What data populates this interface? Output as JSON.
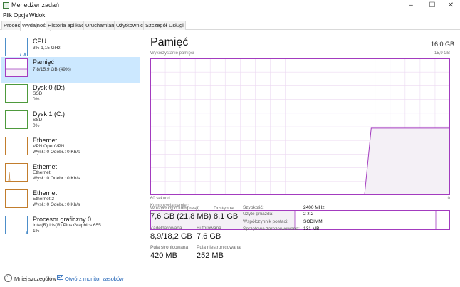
{
  "window": {
    "title": "Menedżer zadań"
  },
  "menu": [
    "Plik",
    "Opcje",
    "Widok"
  ],
  "tabs": [
    {
      "label": "Procesy"
    },
    {
      "label": "Wydajność"
    },
    {
      "label": "Historia aplikacji"
    },
    {
      "label": "Uruchamianie"
    },
    {
      "label": "Użytkownicy"
    },
    {
      "label": "Szczegóły"
    },
    {
      "label": "Usługi"
    }
  ],
  "active_tab": "Wydajność",
  "sidebar": {
    "items": [
      {
        "title": "CPU",
        "sub1": "3% 1,15 GHz",
        "sub2": "",
        "sub3": "",
        "color": "#4d8ec9"
      },
      {
        "title": "Pamięć",
        "sub1": "7,8/15,9 GB (49%)",
        "sub2": "",
        "sub3": "",
        "color": "#a33bbf"
      },
      {
        "title": "Dysk 0 (D:)",
        "sub1": "SSD",
        "sub2": "0%",
        "sub3": "",
        "color": "#4e9a3d"
      },
      {
        "title": "Dysk 1 (C:)",
        "sub1": "SSD",
        "sub2": "0%",
        "sub3": "",
        "color": "#4e9a3d"
      },
      {
        "title": "Ethernet",
        "sub1": "VPN OpenVPN",
        "sub2": "Wysł.: 0 Odebr.: 0 Kb/s",
        "sub3": "",
        "color": "#c27d2d"
      },
      {
        "title": "Ethernet",
        "sub1": "Ethernet",
        "sub2": "Wysł.: 0 Odebr.: 0 Kb/s",
        "sub3": "",
        "color": "#c27d2d"
      },
      {
        "title": "Ethernet",
        "sub1": "Ethernet 2",
        "sub2": "Wysł.: 0 Odebr.: 0 Kb/s",
        "sub3": "",
        "color": "#c27d2d"
      },
      {
        "title": "Procesor graficzny 0",
        "sub1": "Intel(R) Iris(R) Plus Graphics 655",
        "sub2": "1%",
        "sub3": "",
        "color": "#4d8ec9"
      }
    ],
    "selected": "Pamięć"
  },
  "main": {
    "title": "Pamięć",
    "capacity": "16,0 GB",
    "usage_label": "Wykorzystanie pamięci",
    "usage_max": "15,9 GB",
    "time_label": "60 sekund",
    "time_min": "0",
    "composition_label": "Kompozycja pamięci",
    "stats": {
      "in_use_label": "W użyciu (po kompresji)",
      "in_use_value": "7,6 GB (21,8 MB)",
      "available_label": "Dostępna",
      "available_value": "8,1 GB",
      "committed_label": "Zadeklarowana",
      "committed_value": "8,9/18,2 GB",
      "cached_label": "Buforowana",
      "cached_value": "7,6 GB",
      "paged_label": "Pula stronicowana",
      "paged_value": "420 MB",
      "nonpaged_label": "Pula niestronicowana",
      "nonpaged_value": "252 MB"
    },
    "details": {
      "speed_label": "Szybkość:",
      "speed_value": "2400 MHz",
      "slots_label": "Użyte gniazda:",
      "slots_value": "2 z 2",
      "form_label": "Współczynnik postaci:",
      "form_value": "SODIMM",
      "reserved_label": "Sprzętowa zarezerwowana:",
      "reserved_value": "131 MB"
    },
    "usage_fraction": 0.49
  },
  "footer": {
    "less_details": "Mniej szczegółów",
    "resource_monitor": "Otwórz monitor zasobów"
  },
  "colors": {
    "memory": "#a33bbf",
    "memory_fill": "#f4f0f6",
    "selected_bg": "#cce8ff",
    "link": "#1a5fb4"
  }
}
